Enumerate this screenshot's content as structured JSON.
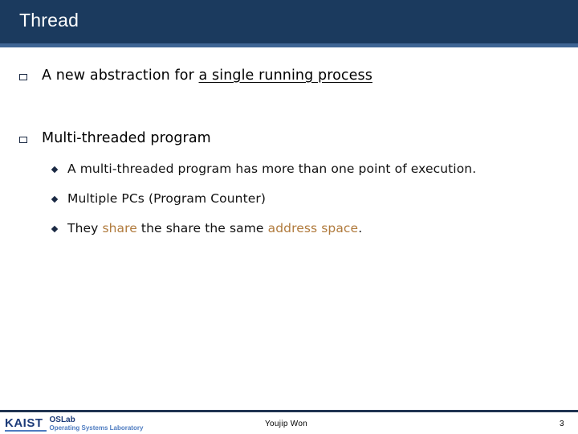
{
  "slide": {
    "title": "Thread",
    "bullets": [
      {
        "prefix": "A new abstraction for ",
        "underlined": "a single running process"
      },
      {
        "text": "Multi-threaded program",
        "sub_bullets": [
          {
            "text": "A multi-threaded program has more than one point of execution."
          },
          {
            "text": "Multiple PCs (Program Counter)"
          },
          {
            "parts": [
              {
                "text": "They ",
                "highlight": false
              },
              {
                "text": "share",
                "highlight": true
              },
              {
                "text": " the share the same ",
                "highlight": false
              },
              {
                "text": "address space",
                "highlight": true
              },
              {
                "text": ".",
                "highlight": false
              }
            ]
          }
        ]
      }
    ]
  },
  "footer": {
    "logo_kaist": "KAIST",
    "logo_lab": "OSLab",
    "logo_lab_full": "Operating Systems Laboratory",
    "author": "Youjip Won",
    "page_number": "3"
  },
  "colors": {
    "header_bg": "#1b3a5e",
    "header_strip": "#3f6594",
    "highlight": "#b07a3c",
    "footer_line": "#1f3350"
  },
  "icons": {
    "level1_bullet": "hollow-square-icon",
    "level2_bullet": "diamond-icon"
  }
}
